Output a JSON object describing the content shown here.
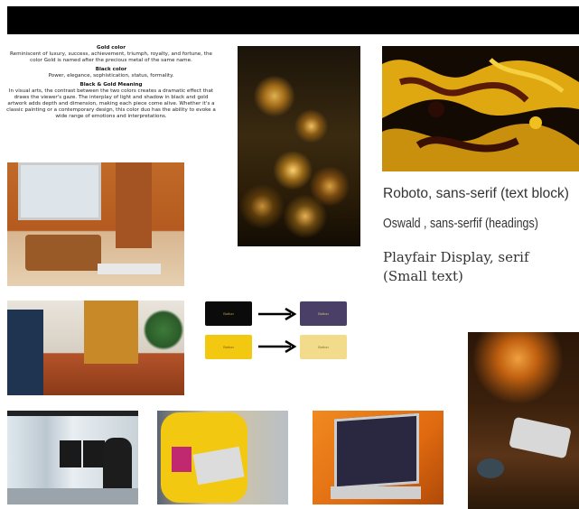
{
  "header": {
    "bar": ""
  },
  "info": {
    "gold_heading": "Gold color",
    "gold_text": "Reminiscent of luxury, success, achievement, triumph, royalty, and fortune, the color Gold is named after the precious metal of the same name.",
    "black_heading": "Black color",
    "black_text": "Power, elegance, sophistication, status, formality.",
    "meaning_heading": "Black & Gold Meaning",
    "meaning_text": "In visual arts, the contrast between the two colors creates a dramatic effect that draws the viewer's gaze. The interplay of light and shadow in black and gold artwork adds depth and dimension, making each piece come alive. Whether it's a classic painting or a contemporary design, this color duo has the ability to evoke a wide range of emotions and interpretations."
  },
  "fonts": {
    "text_block": "Roboto,  sans-serif (text block)",
    "headings": "Oswald , sans-serfif (headings)",
    "small_text": "Playfair Display, serif (Small text)"
  },
  "buttons": {
    "b1_label": "Button",
    "b2_label": "Button",
    "b3_label": "Button",
    "b4_label": "Button"
  },
  "colors": {
    "black": "#0b0b0b",
    "purple": "#4a3f66",
    "gold": "#f2c811",
    "pale_gold": "#f2dc8c"
  }
}
